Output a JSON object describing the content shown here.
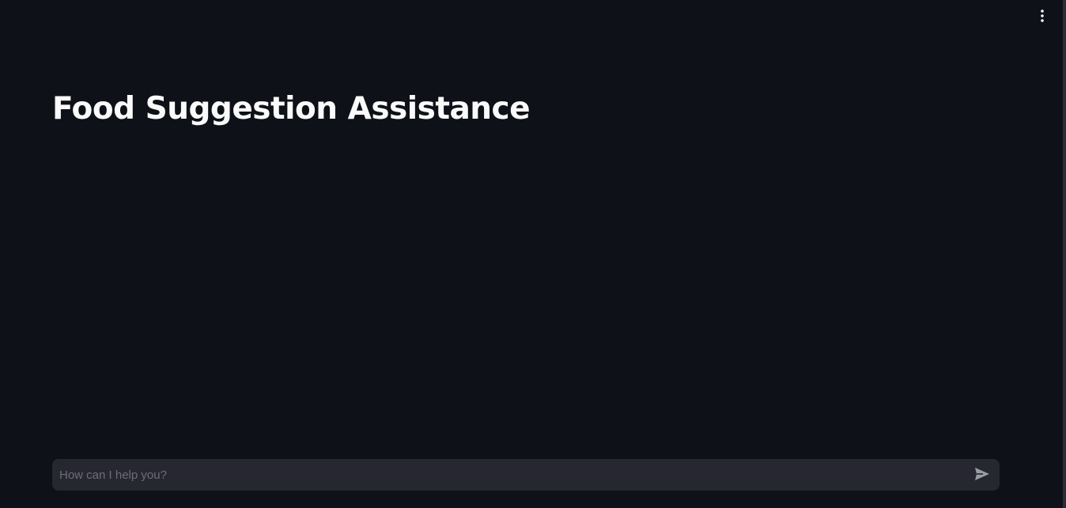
{
  "header": {
    "menu_icon": "more-vertical-icon"
  },
  "main": {
    "title": "Food Suggestion Assistance"
  },
  "chat": {
    "placeholder": "How can I help you?",
    "value": "",
    "send_icon": "send-icon"
  },
  "colors": {
    "background": "#0e1117",
    "input_background": "#262730",
    "title_text": "#fafafa",
    "placeholder_text": "#6b6e78",
    "icon": "#9a9ca3"
  }
}
